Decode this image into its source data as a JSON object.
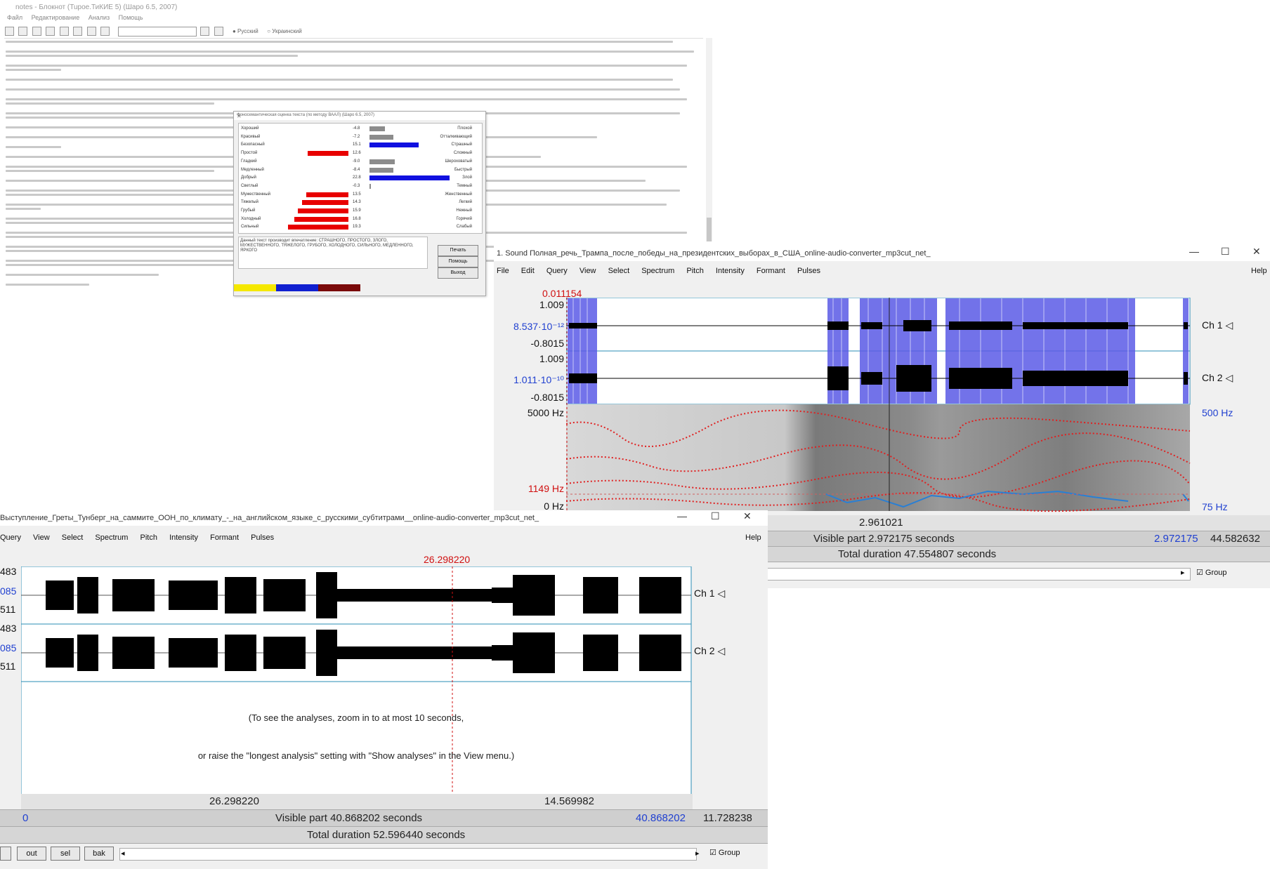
{
  "editor": {
    "title": "notes - Блокнот (Tupoe.ТиКИЕ 5) (Шаро 6.5, 2007)",
    "menu": [
      "Файл",
      "Редактирование",
      "Анализ",
      "Помощь"
    ],
    "radio": [
      "Русский",
      "Украинский"
    ]
  },
  "dialog": {
    "title": "Фоносемантическая оценка текста (по методу ВААЛ) (Шаро 6.5, 2007)",
    "rows": [
      {
        "left": "Хороший",
        "value": "-4.8",
        "right": "Плохой",
        "dir": "pos",
        "mag": 0.18,
        "color": "#8c8c8c"
      },
      {
        "left": "Красивый",
        "value": "-7.2",
        "right": "Отталкивающий",
        "dir": "pos",
        "mag": 0.28,
        "color": "#8c8c8c"
      },
      {
        "left": "Безопасный",
        "value": "15.1",
        "right": "Страшный",
        "dir": "pos",
        "mag": 0.58,
        "color": "#1010e0"
      },
      {
        "left": "Простой",
        "value": "12.6",
        "right": "Сложный",
        "dir": "neg",
        "mag": 0.48,
        "color": "#e80000"
      },
      {
        "left": "Гладкий",
        "value": "-9.0",
        "right": "Шероховатый",
        "dir": "pos",
        "mag": 0.3,
        "color": "#8c8c8c"
      },
      {
        "left": "Медленный",
        "value": "-8.4",
        "right": "Быстрый",
        "dir": "pos",
        "mag": 0.28,
        "color": "#8c8c8c"
      },
      {
        "left": "Добрый",
        "value": "22.8",
        "right": "Злой",
        "dir": "pos",
        "mag": 0.95,
        "color": "#1010e0"
      },
      {
        "left": "Светлый",
        "value": "-0.3",
        "right": "Темный",
        "dir": "pos",
        "mag": 0.01,
        "color": "#8c8c8c"
      },
      {
        "left": "Мужественный",
        "value": "13.5",
        "right": "Женственный",
        "dir": "neg",
        "mag": 0.5,
        "color": "#e80000"
      },
      {
        "left": "Тяжелый",
        "value": "14.3",
        "right": "Легкий",
        "dir": "neg",
        "mag": 0.55,
        "color": "#e80000"
      },
      {
        "left": "Грубый",
        "value": "15.9",
        "right": "Нежный",
        "dir": "neg",
        "mag": 0.6,
        "color": "#e80000"
      },
      {
        "left": "Холодный",
        "value": "16.8",
        "right": "Горячий",
        "dir": "neg",
        "mag": 0.64,
        "color": "#e80000"
      },
      {
        "left": "Сильный",
        "value": "19.3",
        "right": "Слабый",
        "dir": "neg",
        "mag": 0.72,
        "color": "#e80000"
      }
    ],
    "note": "Данный текст производит впечатление: СТРАШНОГО, ПРОСТОГО, ЗЛОГО, МУЖЕСТВЕННОГО, ТЯЖЕЛОГО, ГРУБОГО, ХОЛОДНОГО, СИЛЬНОГО, МЕДЛЕННОГО, ЯРКОГО",
    "buttons": [
      "Печать",
      "Помощь",
      "Выход"
    ],
    "strip_colors": [
      "#f5e800",
      "#1020d0",
      "#7a0a0a"
    ]
  },
  "praatR": {
    "title": "1. Sound Полная_речь_Трампа_после_победы_на_президентских_выборах_в_США_online-audio-converter_mp3cut_net_",
    "menu": [
      "File",
      "Edit",
      "Query",
      "View",
      "Select",
      "Spectrum",
      "Pitch",
      "Intensity",
      "Formant",
      "Pulses"
    ],
    "help": "Help",
    "cursor_time": "0.011154",
    "ch1": {
      "top": "1.009",
      "mid": "8.537·10⁻¹²",
      "bottom": "-0.8015",
      "label": "Ch 1 ◁"
    },
    "ch2": {
      "top": "1.009",
      "mid": "1.011·10⁻¹⁰",
      "bottom": "-0.8015",
      "label": "Ch 2 ◁"
    },
    "spec": {
      "top": "5000 Hz",
      "mid": "1149 Hz",
      "bottom": "0 Hz",
      "right_top": "500 Hz",
      "right_bottom": "75 Hz"
    },
    "sel_duration": "2.961021",
    "visible": "Visible part 2.972175 seconds",
    "visible_end": "2.972175",
    "visible_right": "44.582632",
    "total": "Total duration 47.554807 seconds",
    "group": "Group"
  },
  "praatL": {
    "title": "Выступление_Греты_Тунберг_на_саммите_ООН_по_климату_-_на_английском_языке_с_русскими_субтитрами__online-audio-converter_mp3cut_net_",
    "menu": [
      "Query",
      "View",
      "Select",
      "Spectrum",
      "Pitch",
      "Intensity",
      "Formant",
      "Pulses"
    ],
    "help": "Help",
    "cursor_time": "26.298220",
    "ch1": {
      "top": "483",
      "mid": "085",
      "bottom": "511",
      "label": "Ch 1 ◁"
    },
    "ch2": {
      "top": "483",
      "mid": "085",
      "bottom": "511",
      "label": "Ch 2 ◁"
    },
    "msg1": "(To see the analyses, zoom in to at most 10 seconds,",
    "msg2": "or raise the \"longest analysis\" setting with \"Show analyses\" in the View menu.)",
    "left_dur": "26.298220",
    "right_dur": "14.569982",
    "visible_start": "0",
    "visible": "Visible part 40.868202 seconds",
    "visible_end": "40.868202",
    "visible_right": "11.728238",
    "total": "Total duration 52.596440 seconds",
    "buttons": [
      "out",
      "sel",
      "bak"
    ],
    "group": "Group"
  }
}
